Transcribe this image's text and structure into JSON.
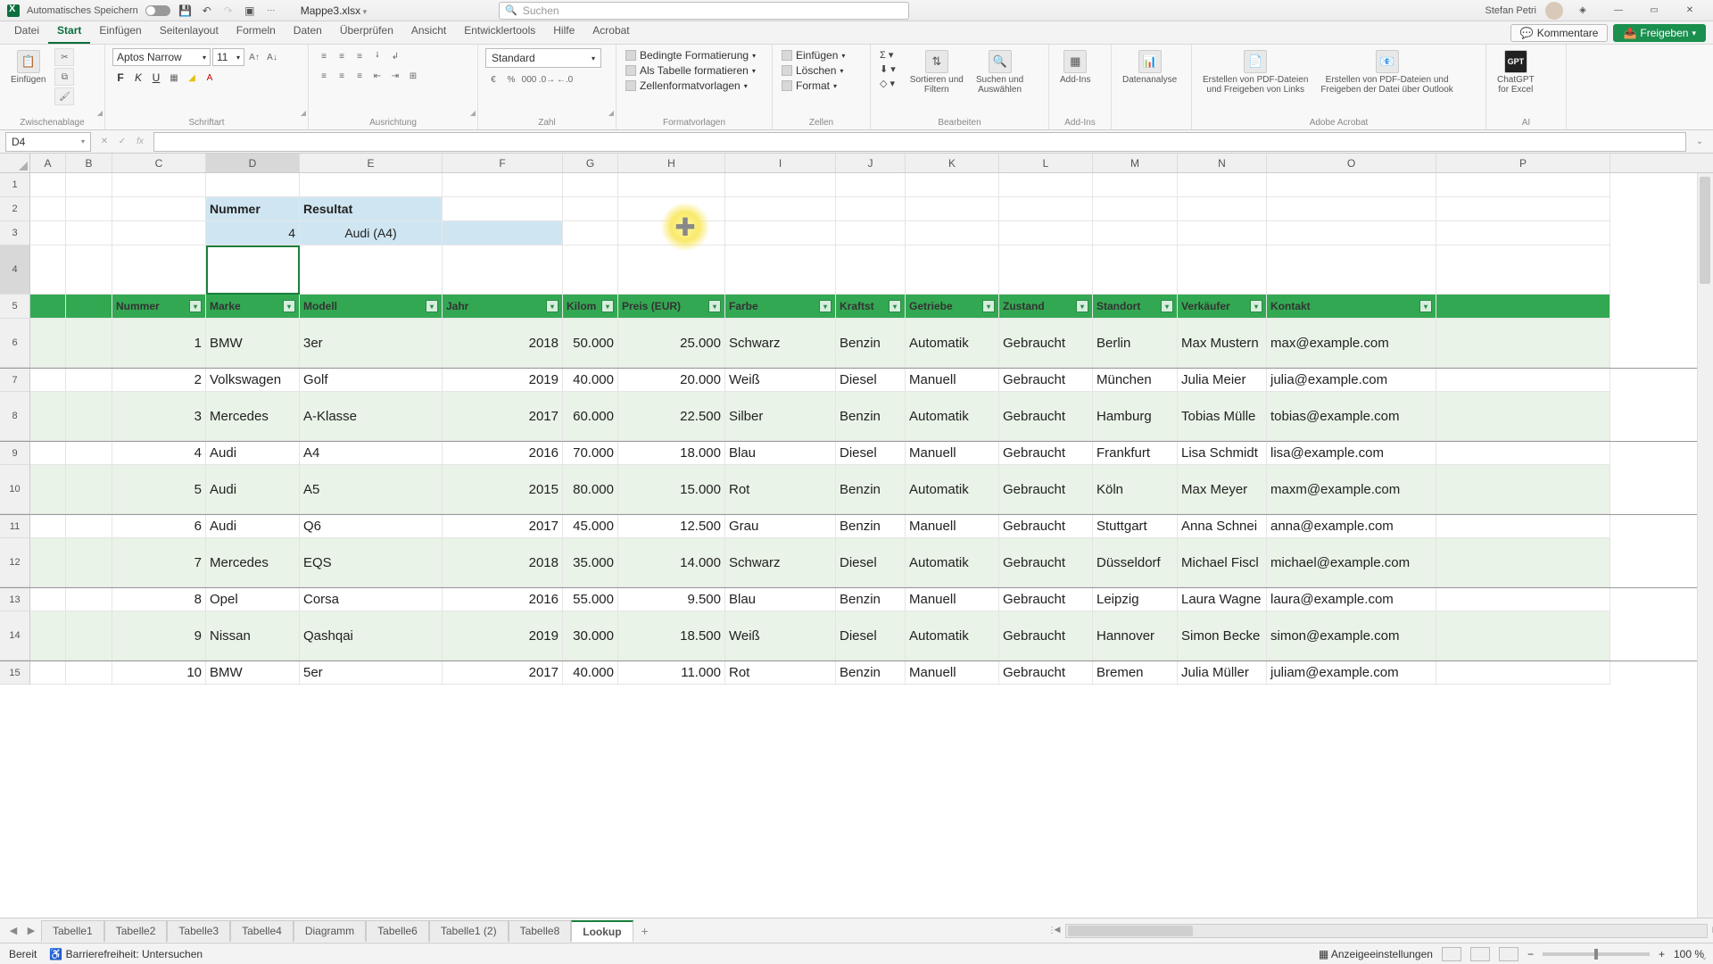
{
  "title": {
    "autosave": "Automatisches Speichern",
    "filename": "Mappe3.xlsx",
    "search_ph": "Suchen",
    "user": "Stefan Petri"
  },
  "tabs": {
    "items": [
      "Datei",
      "Start",
      "Einfügen",
      "Seitenlayout",
      "Formeln",
      "Daten",
      "Überprüfen",
      "Ansicht",
      "Entwicklertools",
      "Hilfe",
      "Acrobat"
    ],
    "active": 1,
    "comments": "Kommentare",
    "share": "Freigeben"
  },
  "ribbon": {
    "paste": "Einfügen",
    "clipboard": "Zwischenablage",
    "font_name": "Aptos Narrow",
    "font_size": "11",
    "font": "Schriftart",
    "align": "Ausrichtung",
    "number_format": "Standard",
    "number": "Zahl",
    "cond": "Bedingte Formatierung",
    "astable": "Als Tabelle formatieren",
    "cellstyles": "Zellenformatvorlagen",
    "styles": "Formatvorlagen",
    "insert": "Einfügen",
    "delete": "Löschen",
    "format": "Format",
    "cells": "Zellen",
    "sortfilter": "Sortieren und\nFiltern",
    "findselect": "Suchen und\nAuswählen",
    "edit": "Bearbeiten",
    "addins": "Add-Ins",
    "addin_btn": "Add-Ins",
    "dataanal": "Datenanalyse",
    "acro1": "Erstellen von PDF-Dateien\nund Freigeben von Links",
    "acro2": "Erstellen von PDF-Dateien und\nFreigeben der Datei über Outlook",
    "acrobat": "Adobe Acrobat",
    "gpt": "ChatGPT\nfor Excel",
    "ai": "AI"
  },
  "fx": {
    "namebox": "D4"
  },
  "cols": [
    "A",
    "B",
    "C",
    "D",
    "E",
    "F",
    "G",
    "H",
    "I",
    "J",
    "K",
    "L",
    "M",
    "N",
    "O",
    "P"
  ],
  "lookup": {
    "h1": "Nummer",
    "h2": "Resultat",
    "v1": "4",
    "v2": "Audi (A4)"
  },
  "headers": [
    "Nummer",
    "Marke",
    "Modell",
    "Jahr",
    "Kilom",
    "Preis (EUR)",
    "Farbe",
    "Kraftst",
    "Getriebe",
    "Zustand",
    "Standort",
    "Verkäufer",
    "Kontakt"
  ],
  "rows": [
    {
      "n": "1",
      "marke": "BMW",
      "modell": "3er",
      "jahr": "2018",
      "km": "50.000",
      "preis": "25.000",
      "farbe": "Schwarz",
      "kraft": "Benzin",
      "getr": "Automatik",
      "zust": "Gebraucht",
      "ort": "Berlin",
      "verk": "Max Mustern",
      "kontakt": "max@example.com"
    },
    {
      "n": "2",
      "marke": "Volkswagen",
      "modell": "Golf",
      "jahr": "2019",
      "km": "40.000",
      "preis": "20.000",
      "farbe": "Weiß",
      "kraft": "Diesel",
      "getr": "Manuell",
      "zust": "Gebraucht",
      "ort": "München",
      "verk": "Julia Meier",
      "kontakt": "julia@example.com"
    },
    {
      "n": "3",
      "marke": "Mercedes",
      "modell": "A-Klasse",
      "jahr": "2017",
      "km": "60.000",
      "preis": "22.500",
      "farbe": "Silber",
      "kraft": "Benzin",
      "getr": "Automatik",
      "zust": "Gebraucht",
      "ort": "Hamburg",
      "verk": "Tobias Mülle",
      "kontakt": "tobias@example.com"
    },
    {
      "n": "4",
      "marke": "Audi",
      "modell": "A4",
      "jahr": "2016",
      "km": "70.000",
      "preis": "18.000",
      "farbe": "Blau",
      "kraft": "Diesel",
      "getr": "Manuell",
      "zust": "Gebraucht",
      "ort": "Frankfurt",
      "verk": "Lisa Schmidt",
      "kontakt": "lisa@example.com"
    },
    {
      "n": "5",
      "marke": "Audi",
      "modell": "A5",
      "jahr": "2015",
      "km": "80.000",
      "preis": "15.000",
      "farbe": "Rot",
      "kraft": "Benzin",
      "getr": "Automatik",
      "zust": "Gebraucht",
      "ort": "Köln",
      "verk": "Max Meyer",
      "kontakt": "maxm@example.com"
    },
    {
      "n": "6",
      "marke": "Audi",
      "modell": "Q6",
      "jahr": "2017",
      "km": "45.000",
      "preis": "12.500",
      "farbe": "Grau",
      "kraft": "Benzin",
      "getr": "Manuell",
      "zust": "Gebraucht",
      "ort": "Stuttgart",
      "verk": "Anna Schnei",
      "kontakt": "anna@example.com"
    },
    {
      "n": "7",
      "marke": "Mercedes",
      "modell": "EQS",
      "jahr": "2018",
      "km": "35.000",
      "preis": "14.000",
      "farbe": "Schwarz",
      "kraft": "Diesel",
      "getr": "Automatik",
      "zust": "Gebraucht",
      "ort": "Düsseldorf",
      "verk": "Michael Fiscl",
      "kontakt": "michael@example.com"
    },
    {
      "n": "8",
      "marke": "Opel",
      "modell": "Corsa",
      "jahr": "2016",
      "km": "55.000",
      "preis": "9.500",
      "farbe": "Blau",
      "kraft": "Benzin",
      "getr": "Manuell",
      "zust": "Gebraucht",
      "ort": "Leipzig",
      "verk": "Laura Wagne",
      "kontakt": "laura@example.com"
    },
    {
      "n": "9",
      "marke": "Nissan",
      "modell": "Qashqai",
      "jahr": "2019",
      "km": "30.000",
      "preis": "18.500",
      "farbe": "Weiß",
      "kraft": "Diesel",
      "getr": "Automatik",
      "zust": "Gebraucht",
      "ort": "Hannover",
      "verk": "Simon Becke",
      "kontakt": "simon@example.com"
    },
    {
      "n": "10",
      "marke": "BMW",
      "modell": "5er",
      "jahr": "2017",
      "km": "40.000",
      "preis": "11.000",
      "farbe": "Rot",
      "kraft": "Benzin",
      "getr": "Manuell",
      "zust": "Gebraucht",
      "ort": "Bremen",
      "verk": "Julia Müller",
      "kontakt": "juliam@example.com"
    }
  ],
  "sheets": {
    "items": [
      "Tabelle1",
      "Tabelle2",
      "Tabelle3",
      "Tabelle4",
      "Diagramm",
      "Tabelle6",
      "Tabelle1 (2)",
      "Tabelle8",
      "Lookup"
    ],
    "active": 8
  },
  "status": {
    "ready": "Bereit",
    "access": "Barrierefreiheit: Untersuchen",
    "display": "Anzeigeeinstellungen",
    "zoom": "100 %"
  }
}
